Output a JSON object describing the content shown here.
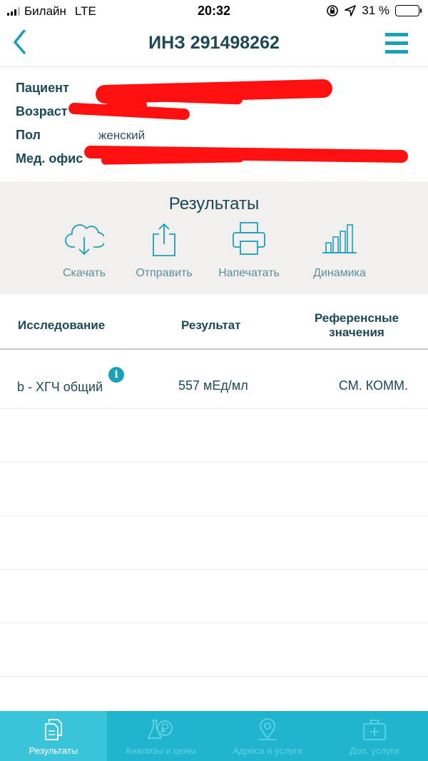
{
  "status_bar": {
    "carrier": "Билайн",
    "network": "LTE",
    "time": "20:32",
    "battery": "31 %",
    "battery_level": 0.31
  },
  "nav": {
    "title": "ИНЗ 291498262",
    "back_icon": "chevron-left-icon",
    "menu_icon": "hamburger-menu-icon"
  },
  "patient": {
    "patient_label": "Пациент",
    "age_label": "Возраст",
    "sex_label": "Пол",
    "sex_value": "женский",
    "office_label": "Мед. офис"
  },
  "results": {
    "title": "Результаты",
    "actions": [
      {
        "label": "Скачать",
        "icon": "cloud-download-icon"
      },
      {
        "label": "Отправить",
        "icon": "share-icon"
      },
      {
        "label": "Напечатать",
        "icon": "printer-icon"
      },
      {
        "label": "Динамика",
        "icon": "bar-chart-icon"
      }
    ]
  },
  "table": {
    "col_study": "Исследование",
    "col_result": "Результат",
    "col_ref_line1": "Референсные",
    "col_ref_line2": "значения",
    "rows": [
      {
        "study": "b - ХГЧ общий",
        "result": "557 мЕд/мл",
        "reference": "СМ. КОММ.",
        "info_icon": "info-icon"
      }
    ]
  },
  "tab_bar": {
    "tabs": [
      {
        "label": "Результаты",
        "icon": "document-icon",
        "active": true
      },
      {
        "label": "Анализы и цены",
        "icon": "flask-ruble-icon",
        "active": false
      },
      {
        "label": "Адреса и услуги",
        "icon": "map-pin-icon",
        "active": false
      },
      {
        "label": "Доп. услуги",
        "icon": "medical-case-icon",
        "active": false
      }
    ]
  },
  "colors": {
    "accent": "#1aa0b8",
    "tab_bar": "#21b4cf",
    "tab_active": "#39c4da",
    "heading": "#1d4856",
    "redaction": "#ff1010"
  }
}
